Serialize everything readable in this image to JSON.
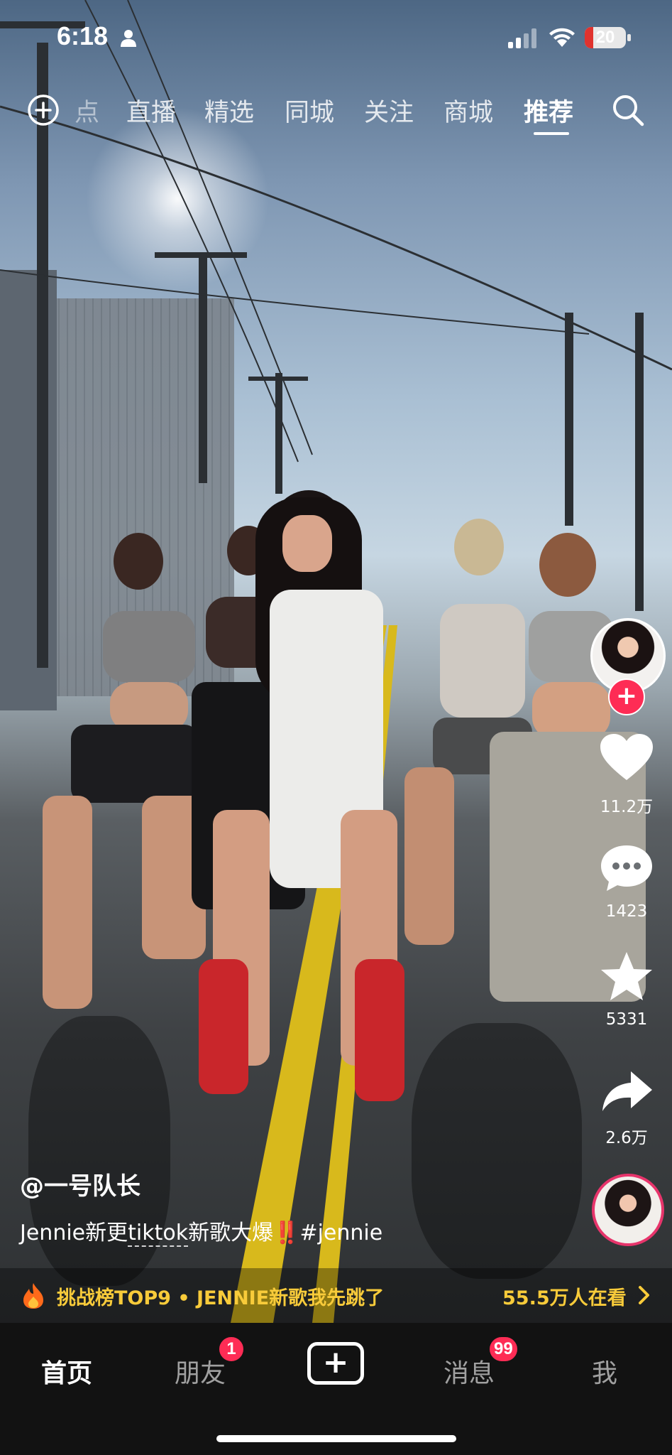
{
  "status_bar": {
    "time": "6:18",
    "battery_level": "20",
    "battery_percent": 20,
    "battery_color": "#e0332e"
  },
  "top_nav": {
    "add_icon": "plus-circle-icon",
    "tabs": [
      {
        "label": "点",
        "active": false
      },
      {
        "label": "直播",
        "active": false
      },
      {
        "label": "精选",
        "active": false
      },
      {
        "label": "同城",
        "active": false
      },
      {
        "label": "关注",
        "active": false
      },
      {
        "label": "商城",
        "active": false
      },
      {
        "label": "推荐",
        "active": true
      }
    ],
    "search_icon": "search-icon"
  },
  "actions": {
    "like_count": "11.2万",
    "comment_count": "1423",
    "favorite_count": "5331",
    "share_count": "2.6万",
    "accent_color": "#fe2c55"
  },
  "post": {
    "author": "@一号队长",
    "caption_pre": "Jennie新更",
    "caption_link": "tiktok",
    "caption_mid": "新歌大爆",
    "caption_excl": "‼️",
    "caption_tag": "#jennie"
  },
  "challenge": {
    "text": "挑战榜TOP9 • JENNIE新歌我先跳了",
    "viewers": "55.5万人在看",
    "color": "#f8cb3a"
  },
  "bottom_tabs": {
    "home": "首页",
    "friends": "朋友",
    "friends_badge": "1",
    "messages": "消息",
    "messages_badge": "99",
    "me": "我"
  }
}
